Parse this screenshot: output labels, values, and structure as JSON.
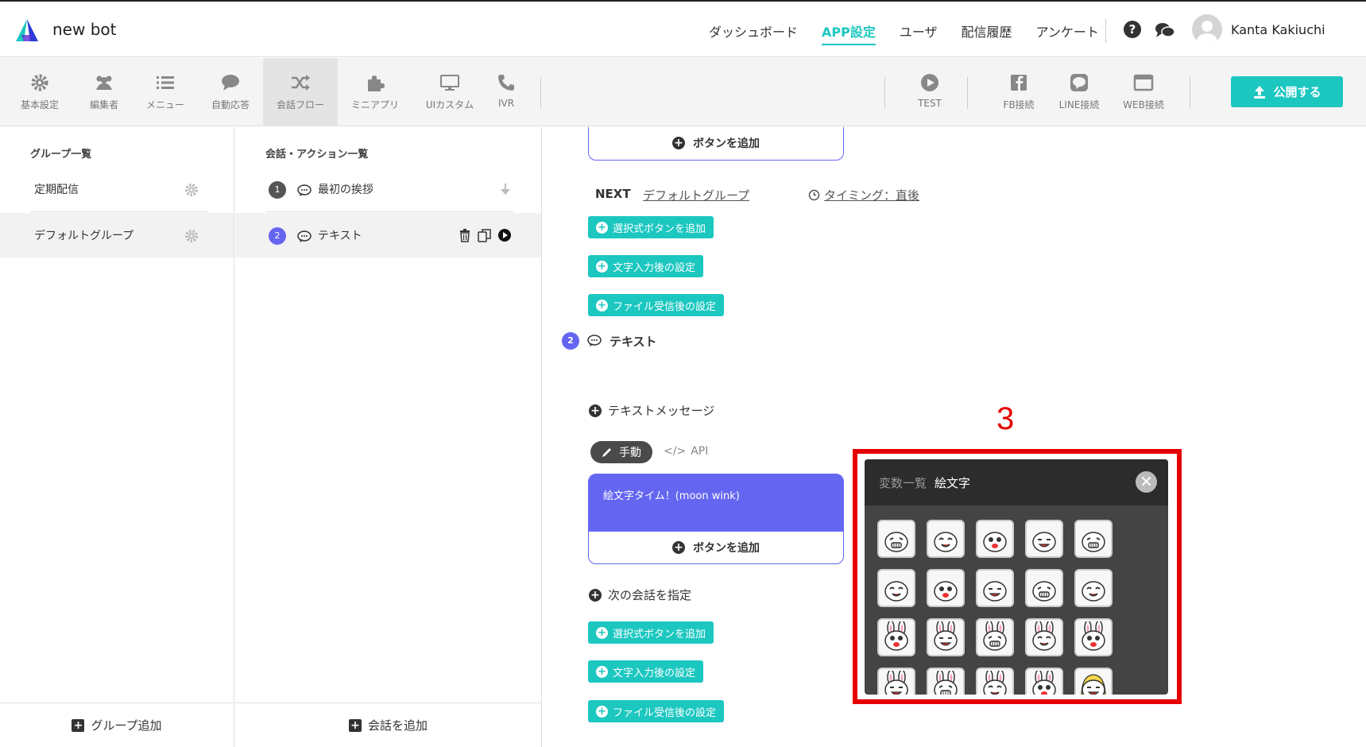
{
  "header": {
    "app_name": "new bot",
    "nav": [
      "ダッシュボード",
      "APP設定",
      "ユーザ",
      "配信履歴",
      "アンケート"
    ],
    "active_nav": "APP設定",
    "user_name": "Kanta Kakiuchi"
  },
  "toolbar": {
    "left_tools": [
      {
        "label": "基本設定",
        "icon": "gear-icon"
      },
      {
        "label": "編集者",
        "icon": "users-icon"
      },
      {
        "label": "メニュー",
        "icon": "list-icon"
      },
      {
        "label": "自動応答",
        "icon": "chat-icon"
      },
      {
        "label": "会話フロー",
        "icon": "shuffle-icon"
      },
      {
        "label": "ミニアプリ",
        "icon": "puzzle-icon"
      },
      {
        "label": "UIカスタム",
        "icon": "monitor-icon"
      },
      {
        "label": "IVR",
        "icon": "phone-icon"
      }
    ],
    "right_tools": [
      {
        "label": "TEST",
        "icon": "play-icon"
      },
      {
        "label": "FB接続",
        "icon": "facebook-icon"
      },
      {
        "label": "LINE接続",
        "icon": "line-icon"
      },
      {
        "label": "WEB接続",
        "icon": "browser-icon"
      }
    ],
    "publish_label": "公開する"
  },
  "groups": {
    "title": "グループ一覧",
    "items": [
      "定期配信",
      "デフォルトグループ"
    ],
    "add_label": "グループ追加"
  },
  "conversations": {
    "title": "会話・アクション一覧",
    "items": [
      {
        "num": "1",
        "label": "最初の挨拶"
      },
      {
        "num": "2",
        "label": "テキスト"
      }
    ],
    "add_label": "会話を追加"
  },
  "main": {
    "add_button_label": "ボタンを追加",
    "next_label": "NEXT",
    "next_target": "デフォルトグループ",
    "timing": "タイミング：直後",
    "choice_button": "選択式ボタンを追加",
    "text_input_setting": "文字入力後の設定",
    "file_setting": "ファイル受信後の設定",
    "step_num": "2",
    "step_title": "テキスト",
    "text_message_label": "テキストメッセージ",
    "mode_manual": "手動",
    "mode_api": "API",
    "message_text": "絵文字タイム！(moon wink)",
    "next_conv_label": "次の会話を指定"
  },
  "popup": {
    "marker": "3",
    "tab_vars": "変数一覧",
    "tab_emoji": "絵文字",
    "emoji_rows": 4,
    "emoji_cols": 5
  },
  "colors": {
    "accent": "#1cc7c0",
    "message_blue": "#6466f1",
    "highlight_red": "#e60000"
  }
}
